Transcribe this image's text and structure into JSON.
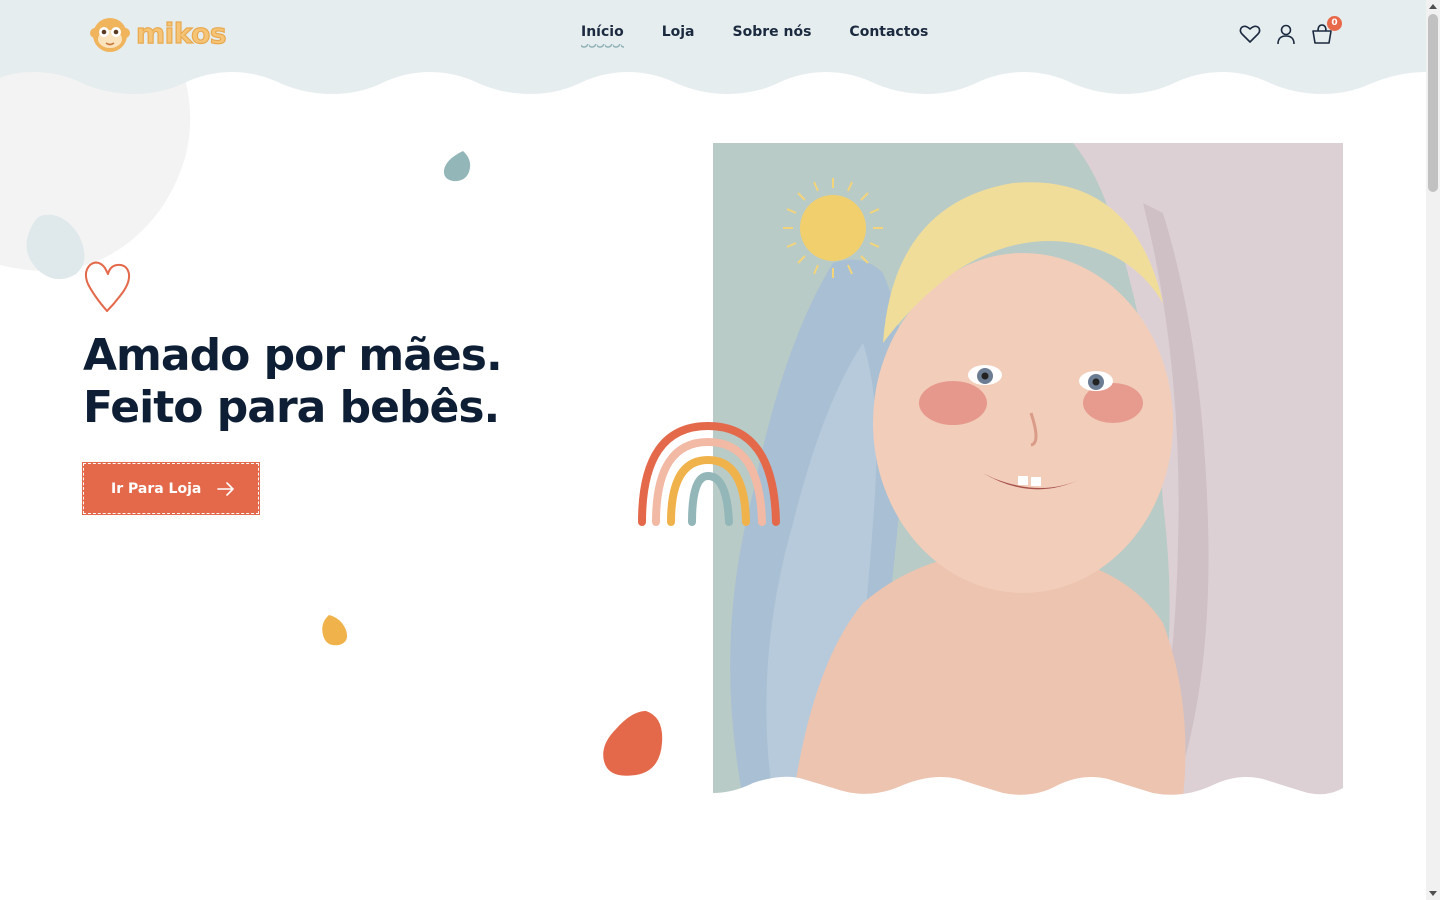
{
  "brand": {
    "name": "mikos",
    "logo_icon": "monkey-face-icon"
  },
  "nav": {
    "items": [
      {
        "label": "Início",
        "active": true
      },
      {
        "label": "Loja",
        "active": false
      },
      {
        "label": "Sobre nós",
        "active": false
      },
      {
        "label": "Contactos",
        "active": false
      }
    ]
  },
  "header_icons": {
    "wishlist": "heart-outline-icon",
    "account": "user-icon",
    "cart": "basket-icon",
    "cart_count": "0"
  },
  "hero": {
    "line1": "Amado por mães.",
    "line2": "Feito para bebês.",
    "cta_label": "Ir Para Loja",
    "cta_icon": "arrow-right-icon"
  },
  "colors": {
    "header_bg": "#e6edef",
    "accent_orange": "#e4694b",
    "accent_teal": "#93b6b8",
    "accent_yellow": "#f0b24a",
    "headline": "#0e1f35",
    "logo": "#f5c477"
  }
}
